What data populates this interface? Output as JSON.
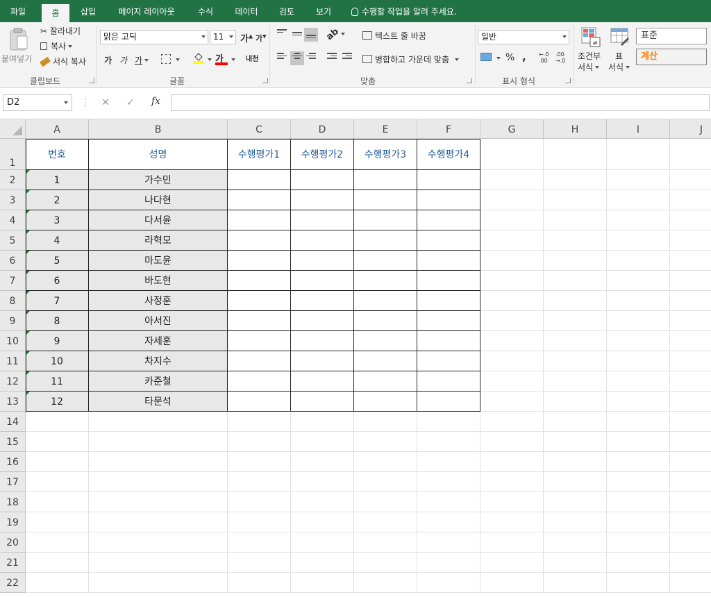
{
  "tabs": [
    "파일",
    "홈",
    "삽입",
    "페이지 레이아웃",
    "수식",
    "데이터",
    "검토",
    "보기"
  ],
  "active_tab": "홈",
  "tell_me": "수행할 작업을 알려 주세요.",
  "ribbon": {
    "clipboard": {
      "paste": "붙여넣기",
      "cut": "잘라내기",
      "copy": "복사",
      "format_painter": "서식 복사",
      "label": "클립보드"
    },
    "font": {
      "name": "맑은 고딕",
      "size": "11",
      "grow": "가",
      "shrink": "가",
      "bold": "가",
      "italic": "가",
      "underline": "가",
      "font_color_glyph": "가",
      "phonetic": "내천",
      "label": "글꼴"
    },
    "alignment": {
      "wrap_text": "텍스트 줄 바꿈",
      "merge_center": "병합하고 가운데 맞춤",
      "label": "맞춤"
    },
    "number": {
      "format": "일반",
      "percent": "%",
      "comma": ",",
      "inc_decimal": "←.0 .00",
      "dec_decimal": ".00 →.0",
      "label": "표시 형식"
    },
    "styles": {
      "conditional": [
        "조건부",
        "서식"
      ],
      "table": [
        "표",
        "서식"
      ],
      "style_normal": "표준",
      "style_calc": "계산"
    }
  },
  "formula_bar": {
    "name_box": "D2",
    "cancel": "✕",
    "enter": "✓",
    "fx": "fx",
    "content": ""
  },
  "sheet": {
    "columns": [
      "A",
      "B",
      "C",
      "D",
      "E",
      "F",
      "G",
      "H",
      "I",
      "J"
    ],
    "rows": [
      "1",
      "2",
      "3",
      "4",
      "5",
      "6",
      "7",
      "8",
      "9",
      "10",
      "11",
      "12",
      "13",
      "14",
      "15",
      "16",
      "17",
      "18",
      "19",
      "20",
      "21",
      "22"
    ],
    "headers": [
      "번호",
      "성명",
      "수행평가1",
      "수행평가2",
      "수행평가3",
      "수행평가4"
    ],
    "records": [
      [
        "1",
        "가수민"
      ],
      [
        "2",
        "나다현"
      ],
      [
        "3",
        "다서윤"
      ],
      [
        "4",
        "라혁모"
      ],
      [
        "5",
        "마도윤"
      ],
      [
        "6",
        "바도현"
      ],
      [
        "7",
        "사정훈"
      ],
      [
        "8",
        "아서진"
      ],
      [
        "9",
        "자세훈"
      ],
      [
        "10",
        "차지수"
      ],
      [
        "11",
        "카준철"
      ],
      [
        "12",
        "타문석"
      ]
    ]
  },
  "colors": {
    "brand": "#217346",
    "header_text": "#1f5c99",
    "style_calc": "#fa7d00",
    "font_color_bar": "#ff0000",
    "highlight_bar": "#ffff00"
  }
}
